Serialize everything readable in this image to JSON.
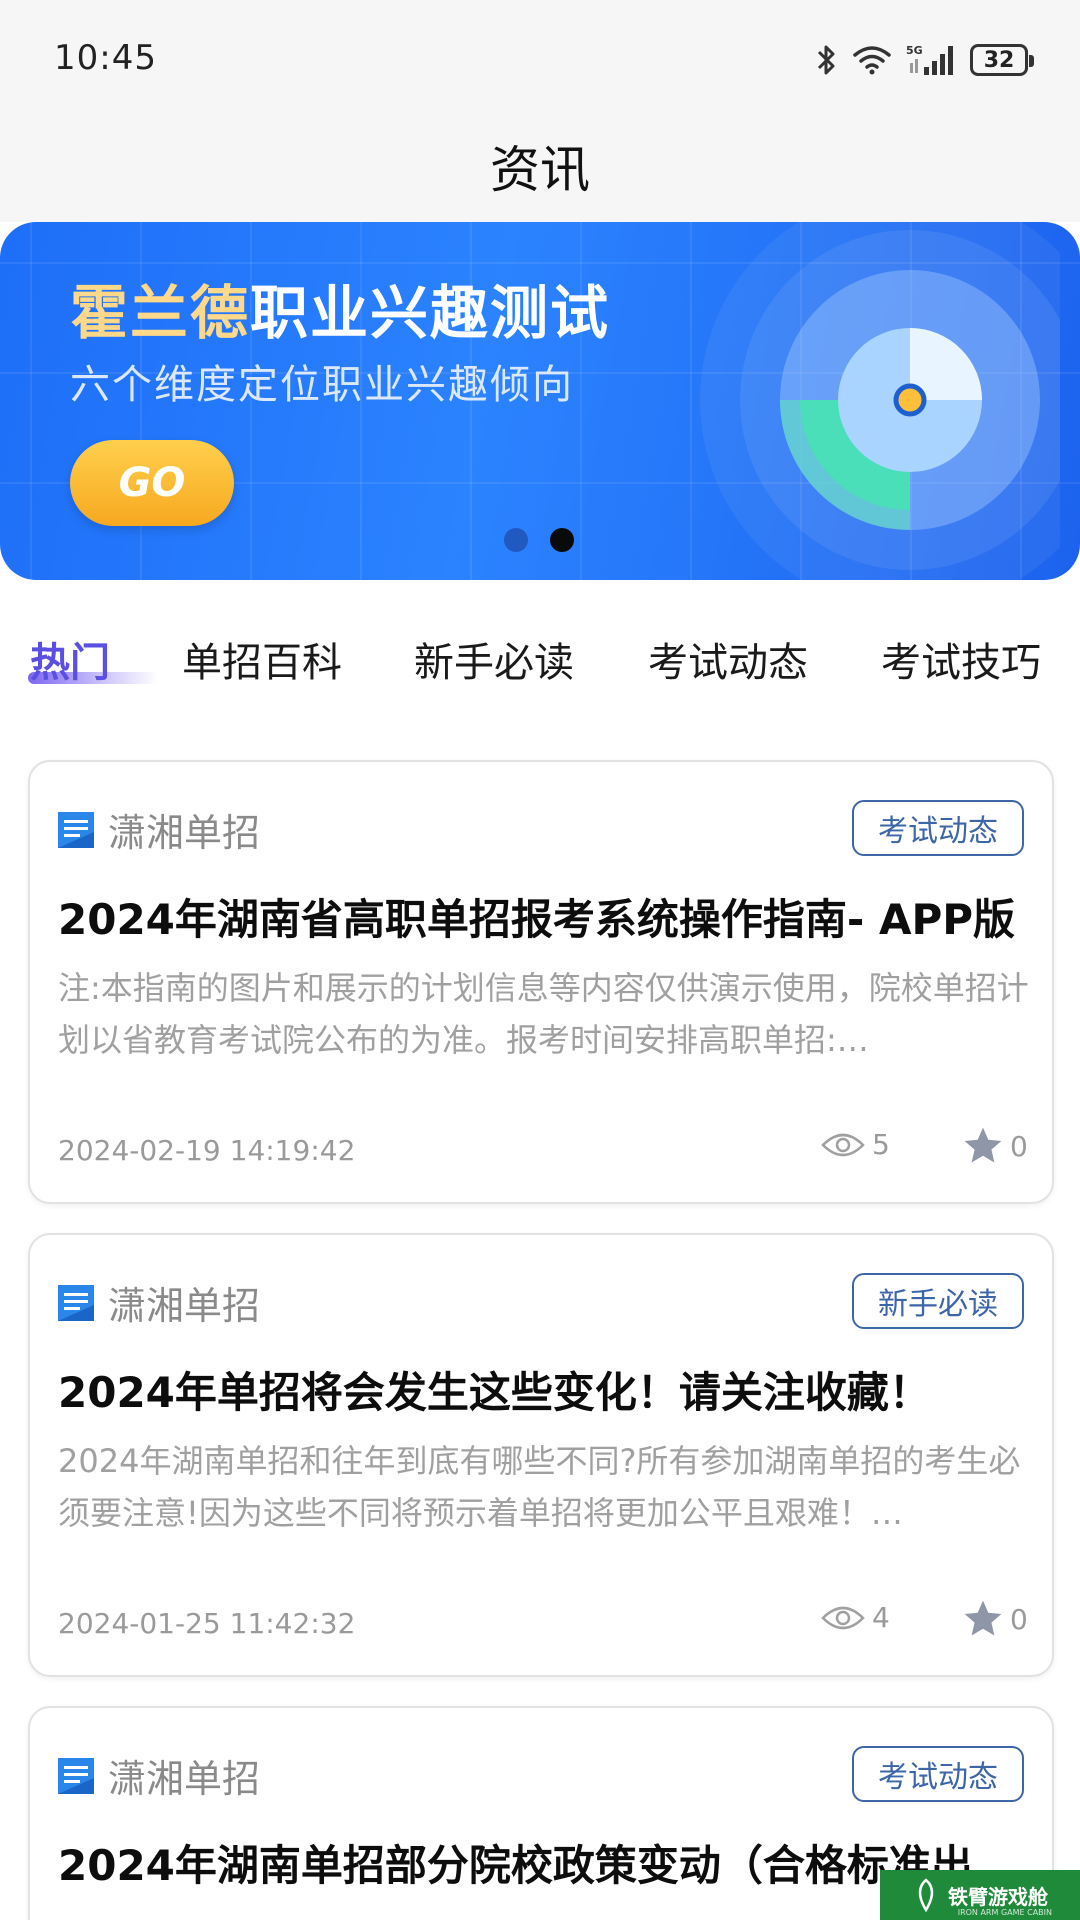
{
  "status_bar": {
    "time": "10:45",
    "battery": "32",
    "network": "5G"
  },
  "header": {
    "title": "资讯"
  },
  "banner": {
    "title_highlight": "霍兰德",
    "title_rest": "职业兴趣测试",
    "subtitle": "六个维度定位职业兴趣倾向",
    "button_label": "GO",
    "dots_count": 2,
    "active_dot": 2
  },
  "tabs": [
    {
      "label": "热门",
      "active": true
    },
    {
      "label": "单招百科",
      "active": false
    },
    {
      "label": "新手必读",
      "active": false
    },
    {
      "label": "考试动态",
      "active": false
    },
    {
      "label": "考试技巧",
      "active": false
    }
  ],
  "articles": [
    {
      "source": "潇湘单招",
      "tag": "考试动态",
      "title": "2024年湖南省高职单招报考系统操作指南- APP版",
      "summary": "注:本指南的图片和展示的计划信息等内容仅供演示使用，院校单招计划以省教育考试院公布的为准。报考时间安排高职单招:…",
      "date": "2024-02-19 14:19:42",
      "views": "5",
      "favorites": "0"
    },
    {
      "source": "潇湘单招",
      "tag": "新手必读",
      "title": "2024年单招将会发生这些变化！请关注收藏！",
      "summary": "2024年湖南单招和往年到底有哪些不同?所有参加湖南单招的考生必须要注意!因为这些不同将预示着单招将更加公平且艰难！…",
      "date": "2024-01-25 11:42:32",
      "views": "4",
      "favorites": "0"
    },
    {
      "source": "潇湘单招",
      "tag": "考试动态",
      "title": "2024年湖南单招部分院校政策变动（合格标准出…",
      "summary": "",
      "date": "",
      "views": "",
      "favorites": ""
    }
  ],
  "source_logo_text": "潇湘单招",
  "watermark": {
    "text": "铁臂游戏舱",
    "sub": "IRON ARM GAME CABIN"
  },
  "colors": {
    "tab_active": "#5a4fe0",
    "tag_border": "#3d66a8",
    "banner_blue": "#1e6ef7",
    "go_button": "#f7a81f"
  }
}
